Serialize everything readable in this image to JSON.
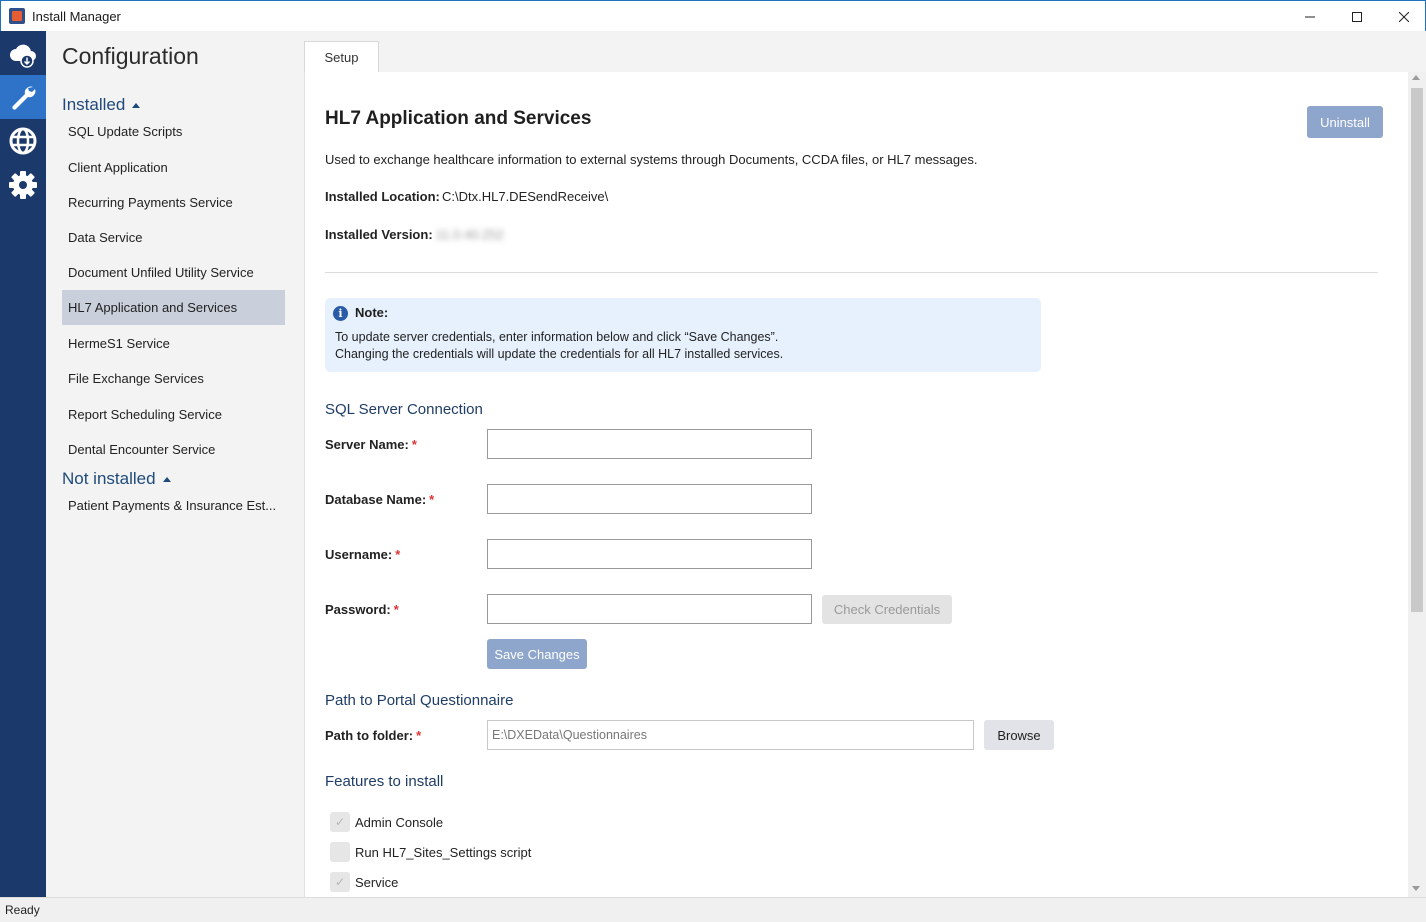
{
  "window": {
    "title": "Install Manager"
  },
  "rail": {
    "icons": [
      "cloud-download-icon",
      "wrench-icon",
      "globe-icon",
      "gear-icon"
    ],
    "active": "wrench-icon"
  },
  "nav": {
    "title": "Configuration",
    "installed_label": "Installed",
    "installed_items": [
      "SQL Update Scripts",
      "Client Application",
      "Recurring Payments Service",
      "Data Service",
      "Document Unfiled Utility Service",
      "HL7 Application and Services",
      "HermeS1 Service",
      "File Exchange Services",
      "Report Scheduling Service",
      "Dental Encounter Service"
    ],
    "selected_item": "HL7 Application and Services",
    "not_installed_label": "Not installed",
    "not_installed_items": [
      "Patient Payments & Insurance Est..."
    ]
  },
  "tabs": [
    {
      "label": "Setup",
      "active": true
    }
  ],
  "main": {
    "title": "HL7 Application and Services",
    "uninstall_label": "Uninstall",
    "description": "Used to exchange healthcare information to external systems through Documents, CCDA files, or HL7 messages.",
    "installed_location_label": "Installed Location:",
    "installed_location_value": "C:\\Dtx.HL7.DESendReceive\\",
    "installed_version_label": "Installed Version:",
    "installed_version_value": "11.0.40.252",
    "note": {
      "title": "Note:",
      "line1": "To update server credentials, enter information below and click “Save Changes”.",
      "line2": "Changing the credentials will update the credentials for all HL7 installed services."
    },
    "sql": {
      "heading": "SQL Server Connection",
      "server_name_label": "Server Name:",
      "server_name_value": "",
      "database_name_label": "Database Name:",
      "database_name_value": "",
      "username_label": "Username:",
      "username_value": "",
      "password_label": "Password:",
      "password_value": "",
      "required_mark": "*",
      "check_credentials_label": "Check Credentials",
      "save_changes_label": "Save Changes"
    },
    "portal": {
      "heading": "Path to Portal Questionnaire",
      "path_label": "Path to folder:",
      "path_value": "E:\\DXEData\\Questionnaires",
      "browse_label": "Browse"
    },
    "features": {
      "heading": "Features to install",
      "items": [
        {
          "label": "Admin Console",
          "checked": true
        },
        {
          "label": "Run HL7_Sites_Settings script",
          "checked": false
        },
        {
          "label": "Service",
          "checked": true
        }
      ]
    }
  },
  "status": {
    "text": "Ready"
  }
}
